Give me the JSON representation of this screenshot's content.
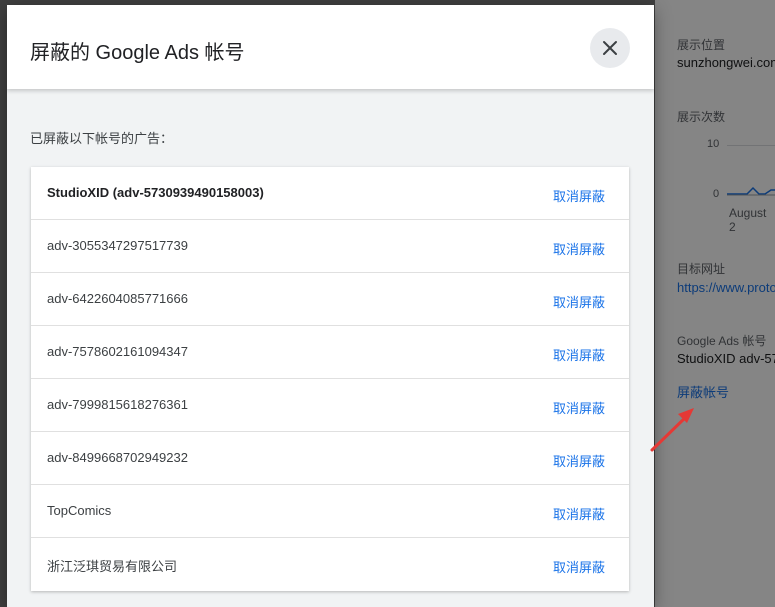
{
  "background_panel": {
    "placement_label": "展示位置",
    "placement_value": "sunzhongwei.com",
    "impressions_label": "展示次数",
    "tick_10": "10",
    "tick_0": "0",
    "date_label": "August 2",
    "target_url_label": "目标网址",
    "target_url_value": "https://www.proto",
    "ads_account_label": "Google Ads 帐号",
    "ads_account_value": "StudioXID adv-57",
    "block_account_link": "屏蔽帐号"
  },
  "dialog": {
    "title": "屏蔽的 Google Ads 帐号",
    "subtitle": "已屏蔽以下帐号的广告：",
    "unblock_label": "取消屏蔽",
    "accounts": [
      {
        "name": "StudioXID (adv-5730939490158003)"
      },
      {
        "name": "adv-3055347297517739"
      },
      {
        "name": "adv-6422604085771666"
      },
      {
        "name": "adv-7578602161094347"
      },
      {
        "name": "adv-7999815618276361"
      },
      {
        "name": "adv-8499668702949232"
      },
      {
        "name": "TopComics"
      },
      {
        "name": "浙江泛琪贸易有限公司"
      }
    ]
  },
  "colors": {
    "link": "#1a73e8",
    "arrow": "#e53935"
  }
}
